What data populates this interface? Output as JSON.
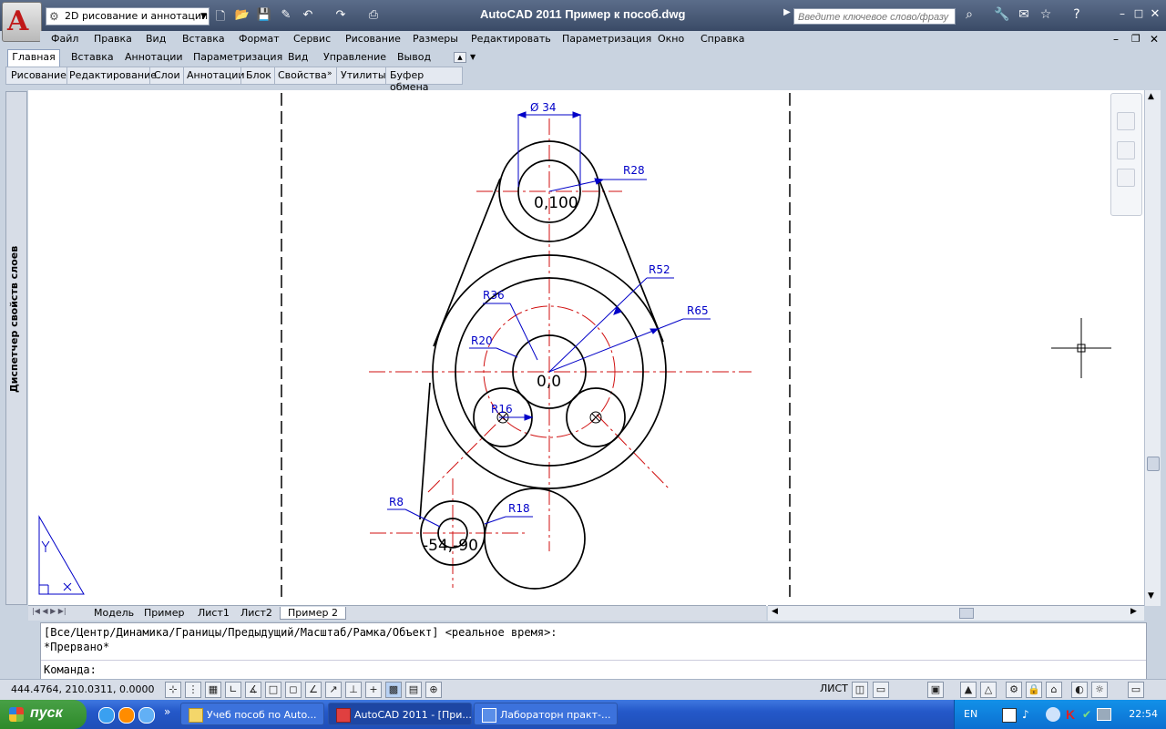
{
  "window": {
    "workspace": "2D рисование и аннотации",
    "title": "AutoCAD 2011    Пример к пособ.dwg",
    "search_placeholder": "Введите ключевое слово/фразу"
  },
  "menu": [
    "Файл",
    "Правка",
    "Вид",
    "Вставка",
    "Формат",
    "Сервис",
    "Рисование",
    "Размеры",
    "Редактировать",
    "Параметризация",
    "Окно",
    "Справка"
  ],
  "ribbon": {
    "tabs": [
      "Главная",
      "Вставка",
      "Аннотации",
      "Параметризация",
      "Вид",
      "Управление",
      "Вывод"
    ],
    "panels": [
      "Рисование",
      "Редактирование",
      "Слои",
      "Аннотации",
      "Блок",
      "Свойства",
      "Утилиты",
      "Буфер обмена"
    ]
  },
  "left_palette": {
    "title": "Диспетчер свойств слоев"
  },
  "drawing": {
    "dim_diameter": "Ø 34",
    "r28": "R28",
    "r52": "R52",
    "r65": "R65",
    "r36": "R36",
    "r20": "R20",
    "r16": "R16",
    "r8": "R8",
    "r18": "R18",
    "pt_top": "0,100",
    "pt_origin": "0,0",
    "pt_left": "-54,-90"
  },
  "layout_tabs": [
    "Модель",
    "Пример",
    "Лист1",
    "Лист2",
    "Пример 2"
  ],
  "command": {
    "line1": "[Все/Центр/Динамика/Границы/Предыдущий/Масштаб/Рамка/Объект] <реальное время>:",
    "line2": "*Прервано*",
    "prompt": "Команда:"
  },
  "status": {
    "coords": "444.4764, 210.0311, 0.0000",
    "sheet": "ЛИСТ"
  },
  "taskbar": {
    "start": "пуск",
    "buttons": [
      "Учеб пособ по Auto...",
      "AutoCAD 2011 - [При...",
      "Лабораторн практ-..."
    ],
    "lang": "EN",
    "time": "22:54"
  },
  "colors": {
    "accent_red": "#d01010",
    "dim_blue": "#0000c8",
    "canvas_bg": "#ffffff",
    "title_bg": "#44546f"
  }
}
